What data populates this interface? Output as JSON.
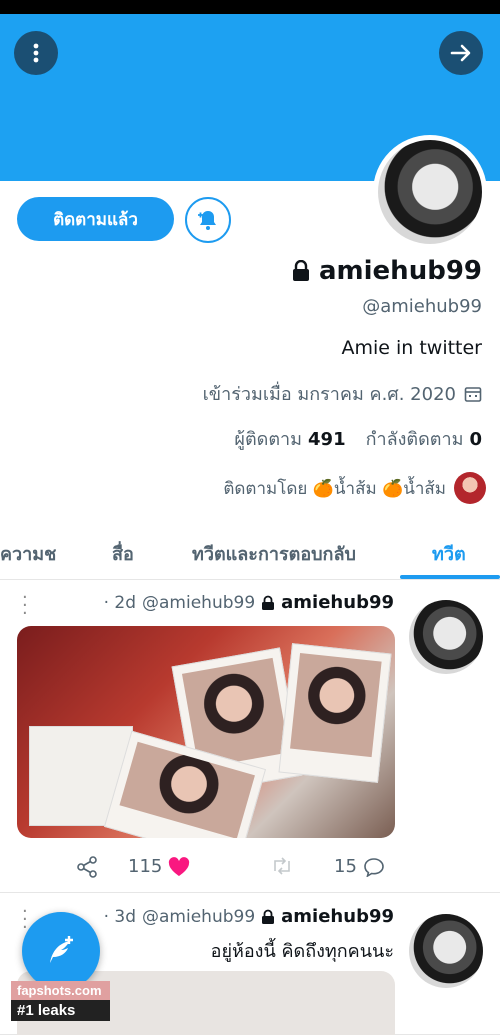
{
  "profile": {
    "display_name": "amiehub99",
    "handle": "@amiehub99",
    "bio": "Amie in twitter",
    "joined": "เข้าร่วมเมื่อ มกราคม ค.ศ. 2020",
    "following_count": "491",
    "following_label": "ผู้ติดตาม",
    "follower_count": "0",
    "follower_label": "กำลังติดตาม",
    "followed_by": "ติดตามโดย 🍊น้ำส้ม 🍊น้ำส้ม"
  },
  "buttons": {
    "follow_label": "ติดตามแล้ว"
  },
  "tabs": [
    {
      "label": "ทวีต",
      "active": true
    },
    {
      "label": "ทวีตและการตอบกลับ",
      "active": false
    },
    {
      "label": "สื่อ",
      "active": false
    },
    {
      "label": "ความช",
      "active": false
    }
  ],
  "tweets": [
    {
      "name": "amiehub99",
      "handle": "@amiehub99",
      "time": "· 2d",
      "replies": "15",
      "likes": "115"
    },
    {
      "name": "amiehub99",
      "handle": "@amiehub99",
      "time": "· 3d",
      "text": "อยู่ห้องนี้ คิดถึงทุกคนนะ"
    }
  ],
  "watermark": {
    "site": "fapshots.com",
    "tagline": "#1 leaks"
  },
  "colors": {
    "accent": "#1d9bf0",
    "banner": "#1da1f2",
    "like": "#f91880"
  }
}
